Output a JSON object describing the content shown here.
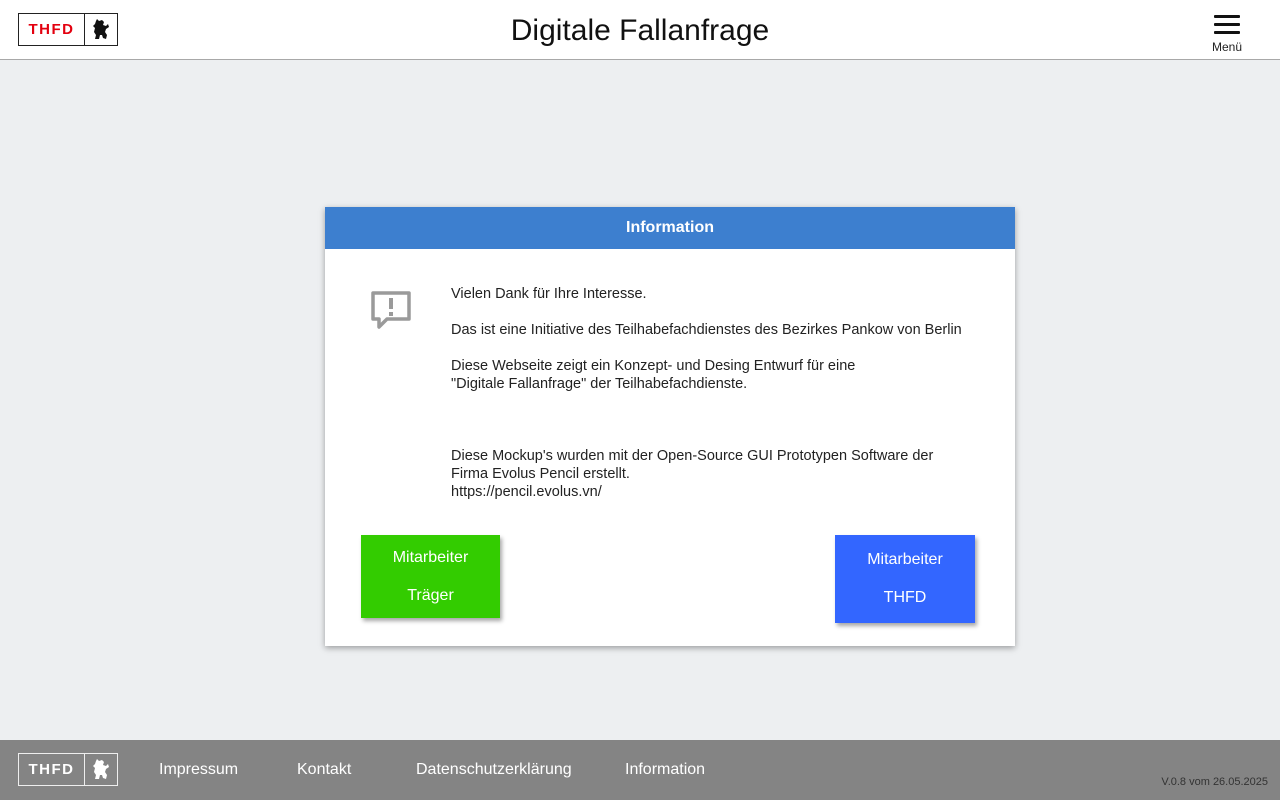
{
  "header": {
    "logo_text": "THFD",
    "title": "Digitale Fallanfrage",
    "menu_label": "Menü"
  },
  "dialog": {
    "title": "Information",
    "icon": "feedback-alert-icon",
    "paragraphs": {
      "p1": "Vielen Dank für Ihre Interesse.",
      "p2": "Das ist eine Initiative des Teilhabefachdienstes des Bezirkes Pankow von Berlin",
      "p3_line1": "Diese Webseite zeigt ein Konzept- und Desing Entwurf für eine",
      "p3_line2": "\"Digitale Fallanfrage\" der Teilhabefachdienste.",
      "p4_line1": "Diese Mockup's wurden mit der Open-Source GUI Prototypen Software der",
      "p4_line2": "Firma Evolus Pencil erstellt.",
      "p4_line3": "https://pencil.evolus.vn/"
    },
    "buttons": {
      "traeger_line1": "Mitarbeiter",
      "traeger_line2": "Träger",
      "thfd_line1": "Mitarbeiter",
      "thfd_line2": "THFD"
    }
  },
  "footer": {
    "logo_text": "THFD",
    "links": {
      "impressum": "Impressum",
      "kontakt": "Kontakt",
      "datenschutz": "Datenschutzerklärung",
      "information": "Information"
    },
    "version": "V.0.8 vom 26.05.2025"
  },
  "colors": {
    "dialog_header": "#3d7fcf",
    "button_traeger": "#33cc00",
    "button_thfd": "#3366ff",
    "footer_bg": "#848484",
    "logo_red": "#e3000f"
  }
}
